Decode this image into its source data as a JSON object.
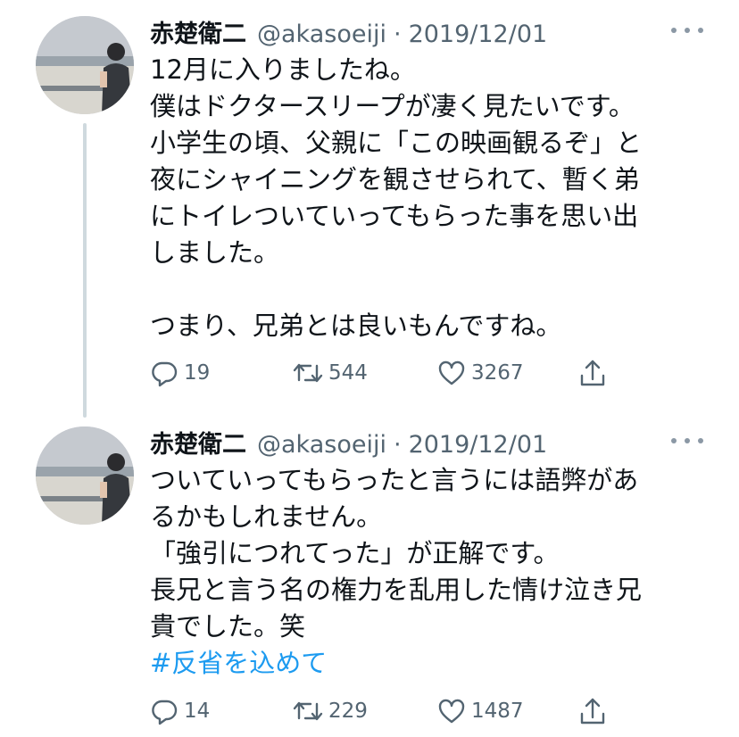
{
  "tweets": [
    {
      "author_name": "赤楚衛二",
      "handle": "@akasoeiji",
      "separator": "·",
      "date": "2019/12/01",
      "text": "12月に入りましたね。\n僕はドクタースリープが凄く見たいです。\n小学生の頃、父親に「この映画観るぞ」と\n夜にシャイニングを観させられて、暫く弟\nにトイレついていってもらった事を思い出\nしました。\n\nつまり、兄弟とは良いもんですね。",
      "hashtag": "",
      "replies": "19",
      "retweets": "544",
      "likes": "3267",
      "icons": {
        "more": "more-icon",
        "reply": "reply-icon",
        "retweet": "retweet-icon",
        "like": "heart-icon",
        "share": "share-icon"
      }
    },
    {
      "author_name": "赤楚衛二",
      "handle": "@akasoeiji",
      "separator": "·",
      "date": "2019/12/01",
      "text": "ついていってもらったと言うには語弊があ\nるかもしれません。\n「強引につれてった」が正解です。\n長兄と言う名の権力を乱用した情け泣き兄\n貴でした。笑",
      "hashtag": "#反省を込めて",
      "replies": "14",
      "retweets": "229",
      "likes": "1487",
      "icons": {
        "more": "more-icon",
        "reply": "reply-icon",
        "retweet": "retweet-icon",
        "like": "heart-icon",
        "share": "share-icon"
      }
    }
  ],
  "colors": {
    "text": "#0f1419",
    "secondary": "#536471",
    "hashtag": "#1d9bf0",
    "thread_line": "#cfd9de"
  }
}
